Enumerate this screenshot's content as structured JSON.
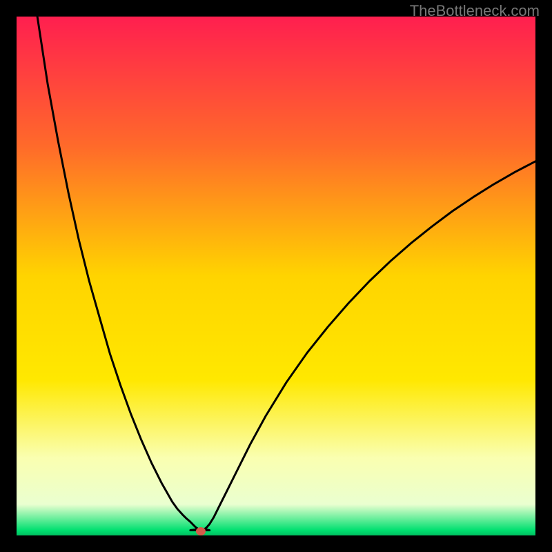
{
  "watermark": "TheBottleneck.com",
  "chart_data": {
    "type": "line",
    "title": "",
    "xlabel": "",
    "ylabel": "",
    "xlim": [
      0,
      1
    ],
    "ylim": [
      0,
      1
    ],
    "gradient_stops": [
      {
        "offset": 0.0,
        "color": "#ff1f4f"
      },
      {
        "offset": 0.25,
        "color": "#ff6a2a"
      },
      {
        "offset": 0.5,
        "color": "#ffd400"
      },
      {
        "offset": 0.7,
        "color": "#ffe800"
      },
      {
        "offset": 0.85,
        "color": "#faffb0"
      },
      {
        "offset": 0.94,
        "color": "#eaffd0"
      },
      {
        "offset": 0.99,
        "color": "#00e070"
      },
      {
        "offset": 1.0,
        "color": "#00c060"
      }
    ],
    "marker": {
      "x": 0.355,
      "y": 0.992,
      "color": "#d45a4a"
    },
    "series": [
      {
        "name": "left-branch",
        "x": [
          0.04,
          0.06,
          0.08,
          0.1,
          0.12,
          0.14,
          0.16,
          0.18,
          0.2,
          0.22,
          0.24,
          0.26,
          0.28,
          0.3,
          0.31,
          0.32,
          0.328,
          0.334,
          0.338,
          0.341,
          0.344,
          0.346,
          0.348,
          0.35
        ],
        "y": [
          0.0,
          0.13,
          0.24,
          0.34,
          0.43,
          0.51,
          0.58,
          0.65,
          0.71,
          0.765,
          0.815,
          0.86,
          0.9,
          0.935,
          0.949,
          0.96,
          0.968,
          0.973,
          0.977,
          0.98,
          0.983,
          0.985,
          0.986,
          0.988
        ]
      },
      {
        "name": "floor",
        "x": [
          0.335,
          0.372
        ],
        "y": [
          0.99,
          0.99
        ]
      },
      {
        "name": "right-branch",
        "x": [
          0.362,
          0.366,
          0.372,
          0.38,
          0.39,
          0.405,
          0.425,
          0.45,
          0.48,
          0.52,
          0.56,
          0.6,
          0.64,
          0.68,
          0.72,
          0.76,
          0.8,
          0.84,
          0.88,
          0.92,
          0.96,
          1.0
        ],
        "y": [
          0.988,
          0.985,
          0.978,
          0.965,
          0.945,
          0.915,
          0.875,
          0.825,
          0.77,
          0.705,
          0.648,
          0.598,
          0.552,
          0.51,
          0.472,
          0.437,
          0.405,
          0.375,
          0.348,
          0.323,
          0.3,
          0.279
        ]
      }
    ]
  }
}
